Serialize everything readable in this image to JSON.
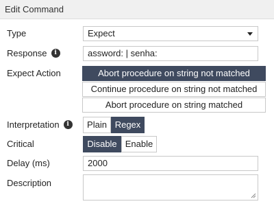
{
  "header": {
    "title": "Edit Command"
  },
  "form": {
    "type": {
      "label": "Type",
      "value": "Expect"
    },
    "response": {
      "label": "Response",
      "value": "assword: | senha:",
      "info_icon": "info-icon"
    },
    "expect_action": {
      "label": "Expect Action",
      "options": [
        "Abort procedure on string not matched",
        "Continue procedure on string not matched",
        "Abort procedure on string matched"
      ],
      "selected": 0
    },
    "interpretation": {
      "label": "Interpretation",
      "info_icon": "info-icon",
      "options": [
        "Plain",
        "Regex"
      ],
      "selected": "Regex"
    },
    "critical": {
      "label": "Critical",
      "options": [
        "Disable",
        "Enable"
      ],
      "selected": "Disable"
    },
    "delay": {
      "label": "Delay (ms)",
      "value": "2000"
    },
    "description": {
      "label": "Description",
      "value": ""
    }
  },
  "colors": {
    "accent": "#3f4a5f",
    "header_bg": "#f0f0f0",
    "border": "#c8c8c8"
  }
}
